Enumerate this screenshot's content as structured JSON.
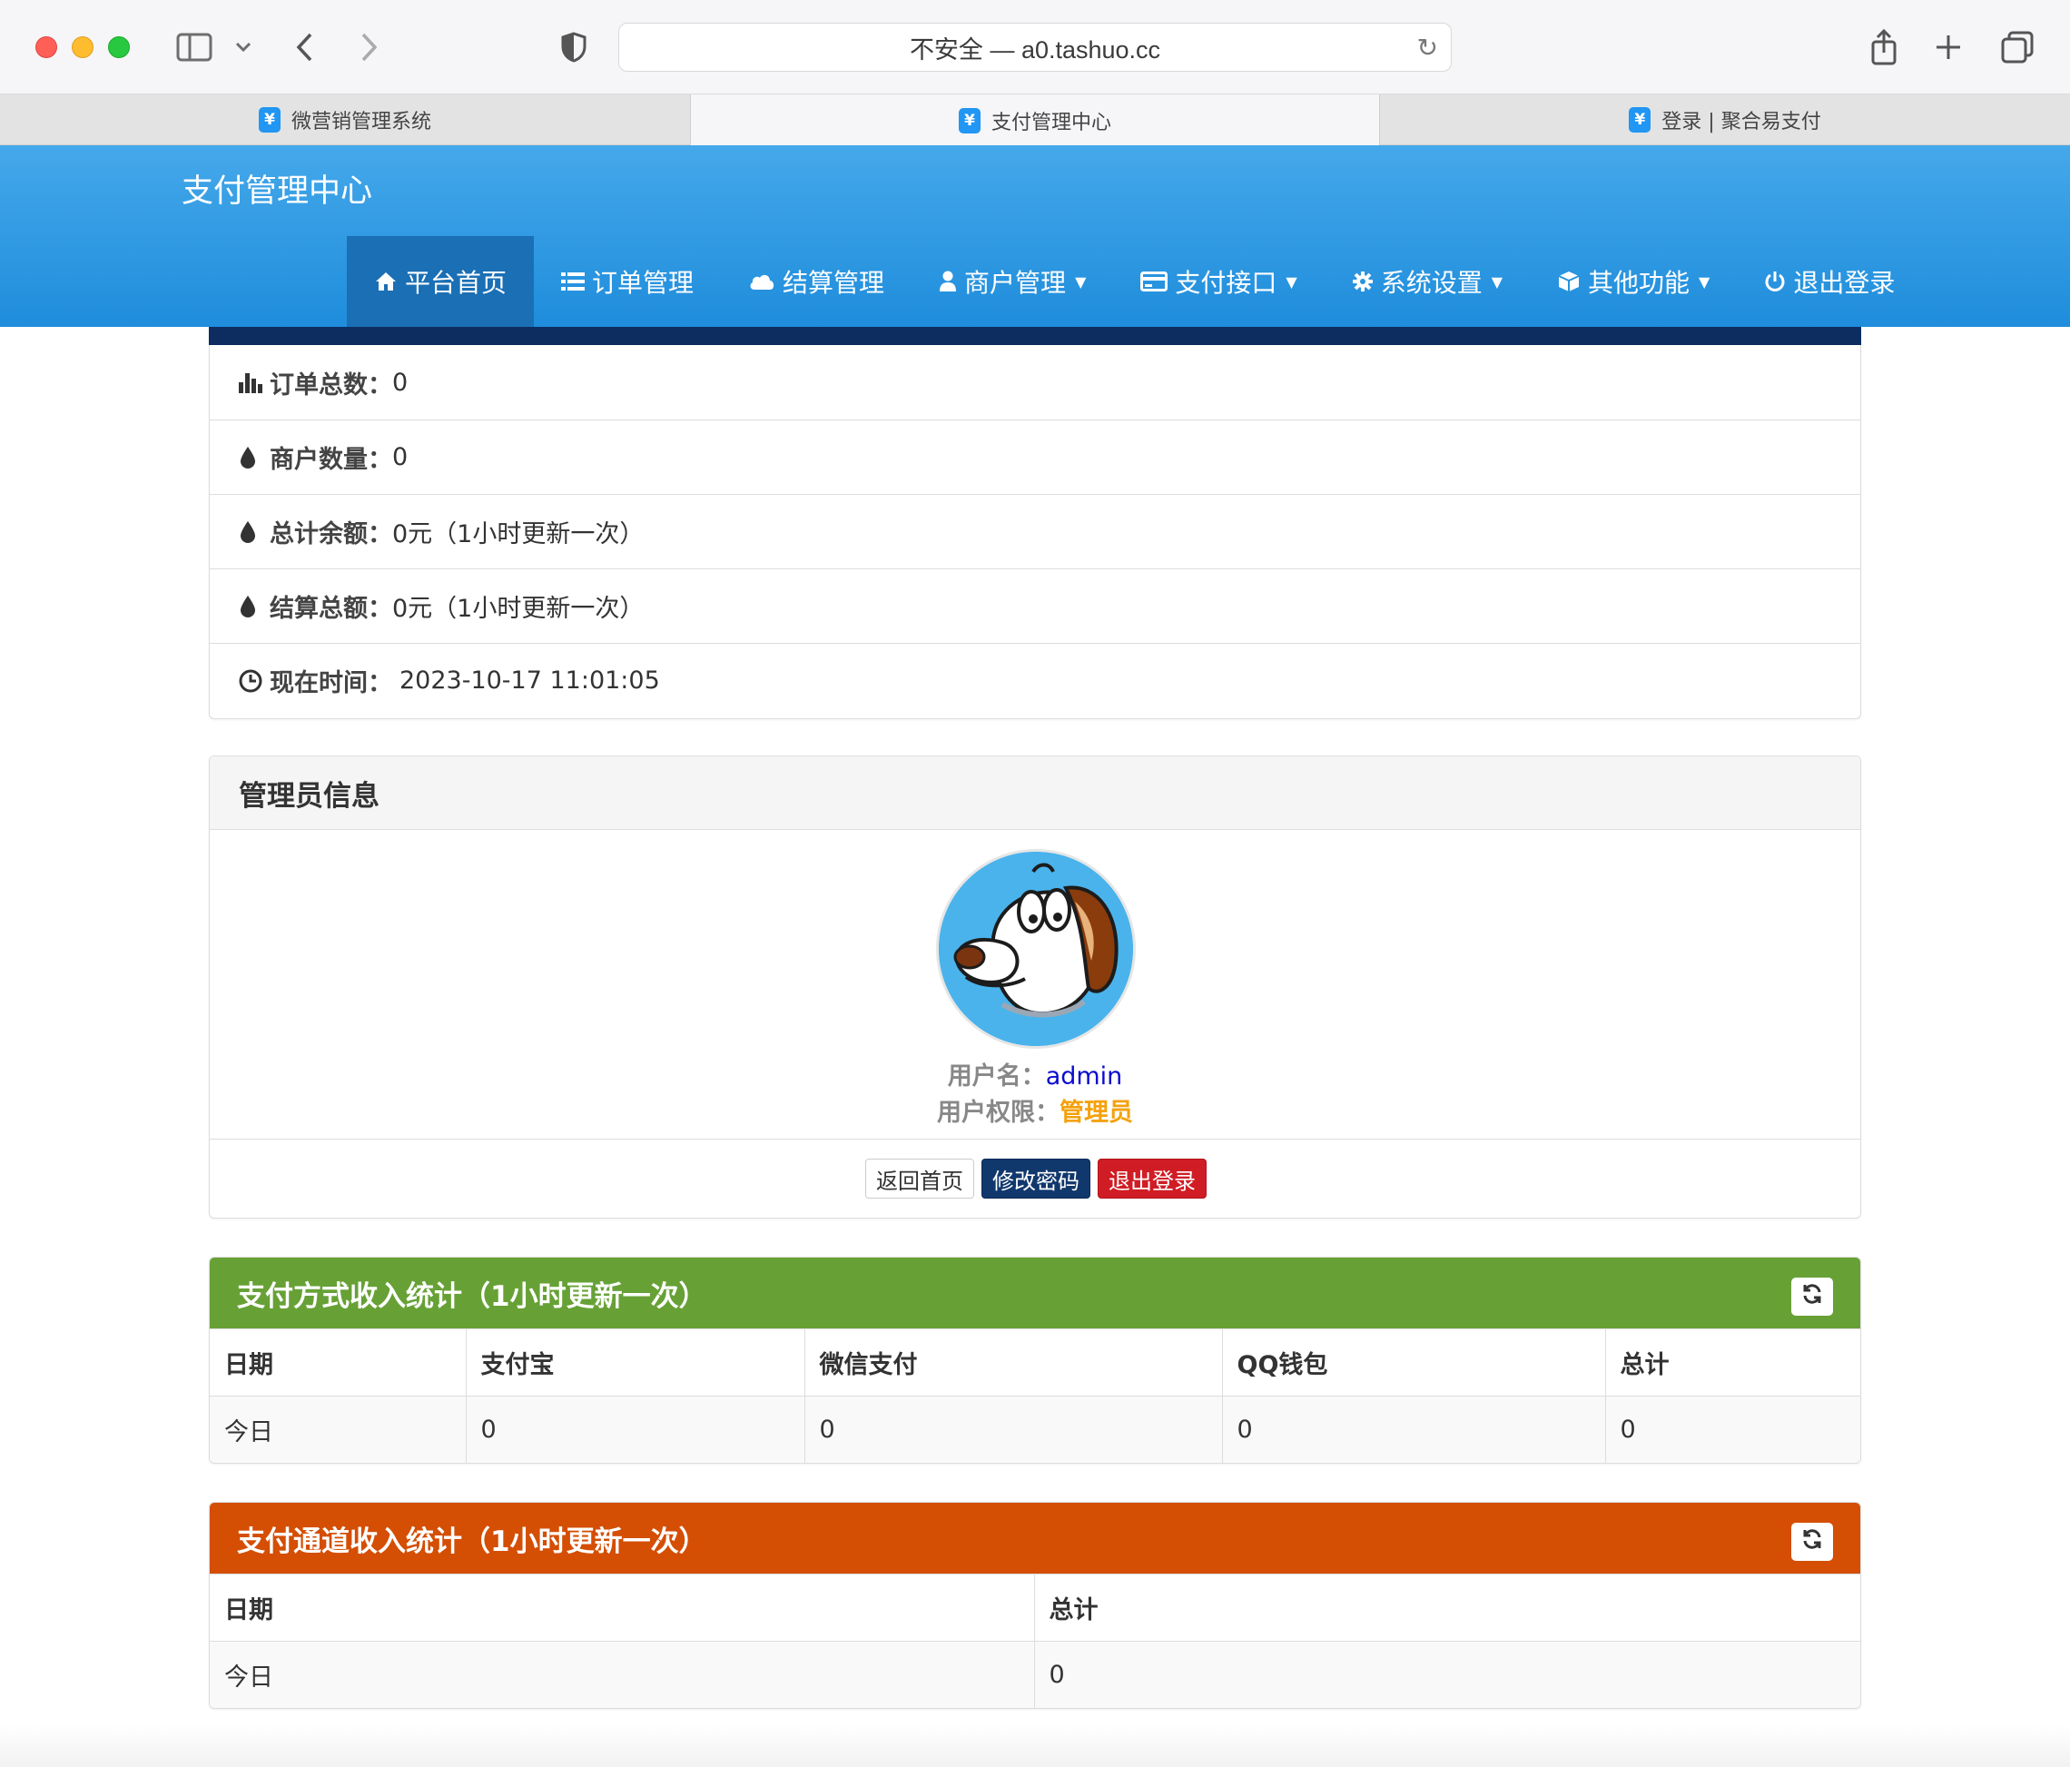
{
  "browser": {
    "address": "不安全 — a0.tashuo.cc",
    "tabs": [
      {
        "label": "微营销管理系统",
        "active": false
      },
      {
        "label": "支付管理中心",
        "active": true
      },
      {
        "label": "登录 | 聚合易支付",
        "active": false
      }
    ],
    "favicon_glyph": "¥"
  },
  "header": {
    "brand": "支付管理中心",
    "nav": [
      {
        "label": "平台首页",
        "icon": "home-icon",
        "active": true
      },
      {
        "label": "订单管理",
        "icon": "list-icon"
      },
      {
        "label": "结算管理",
        "icon": "cloud-icon"
      },
      {
        "label": "商户管理",
        "icon": "user-icon",
        "dropdown": true
      },
      {
        "label": "支付接口",
        "icon": "credit-card-icon",
        "dropdown": true
      },
      {
        "label": "系统设置",
        "icon": "gear-icon",
        "dropdown": true
      },
      {
        "label": "其他功能",
        "icon": "box-icon",
        "dropdown": true
      },
      {
        "label": "退出登录",
        "icon": "power-icon"
      }
    ]
  },
  "stats": {
    "orders_label": "订单总数：",
    "orders_value": "0",
    "merchants_label": "商户数量：",
    "merchants_value": "0",
    "balance_label": "总计余额：",
    "balance_value": "0元（1小时更新一次）",
    "settle_label": "结算总额：",
    "settle_value": "0元（1小时更新一次）",
    "time_label": "现在时间：",
    "time_value": "2023-10-17 11:01:05"
  },
  "admin": {
    "title": "管理员信息",
    "username_label": "用户名：",
    "username": "admin",
    "role_label": "用户权限：",
    "role": "管理员",
    "buttons": {
      "home": "返回首页",
      "change_password": "修改密码",
      "logout": "退出登录"
    }
  },
  "method_stats": {
    "title": "支付方式收入统计（1小时更新一次）",
    "color": "#67a136",
    "headers": [
      "日期",
      "支付宝",
      "微信支付",
      "QQ钱包",
      "总计"
    ],
    "row": [
      "今日",
      "0",
      "0",
      "0",
      "0"
    ]
  },
  "channel_stats": {
    "title": "支付通道收入统计（1小时更新一次）",
    "color": "#d44e04",
    "headers": [
      "日期",
      "总计"
    ],
    "row": [
      "今日",
      "0"
    ]
  }
}
